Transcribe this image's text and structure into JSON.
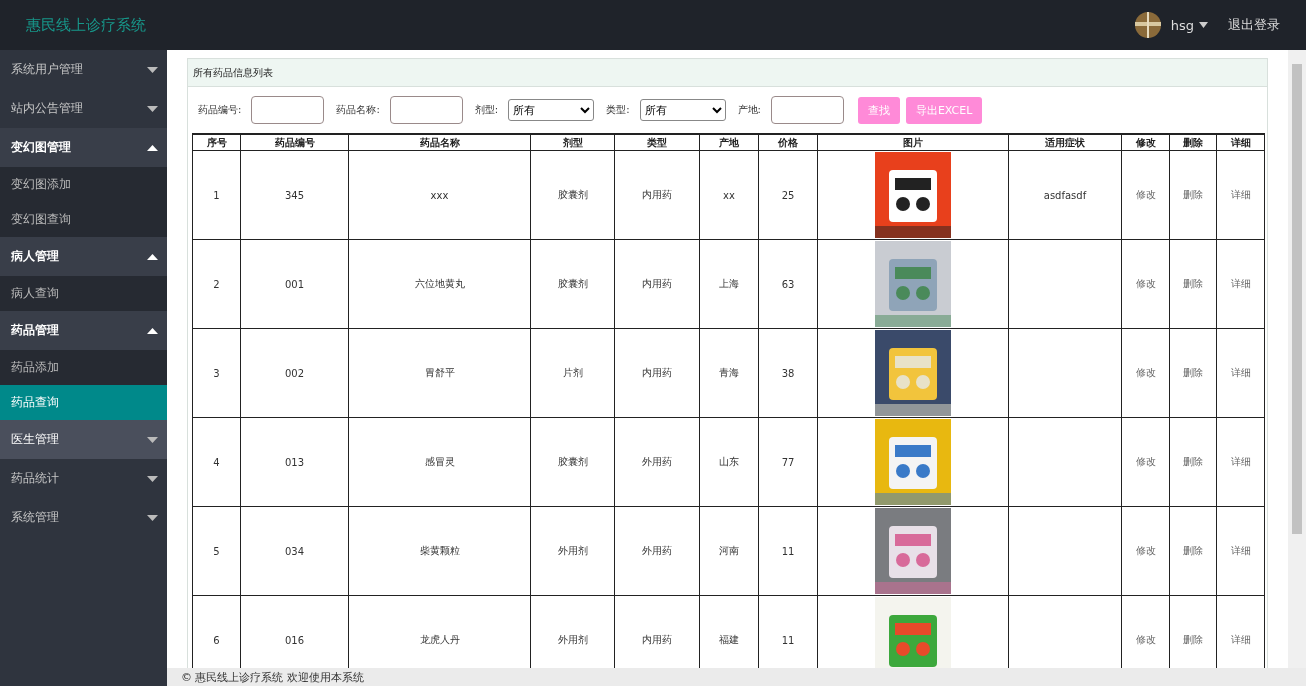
{
  "header": {
    "title": "惠民线上诊疗系统",
    "user": "hsg",
    "logout": "退出登录"
  },
  "sidebar": {
    "items": [
      {
        "label": "系统用户管理",
        "expanded": false,
        "hovered": false
      },
      {
        "label": "站内公告管理",
        "expanded": false,
        "hovered": false
      },
      {
        "label": "变幻图管理",
        "expanded": true,
        "hovered": false,
        "children": [
          {
            "label": "变幻图添加",
            "selected": false
          },
          {
            "label": "变幻图查询",
            "selected": false
          }
        ]
      },
      {
        "label": "病人管理",
        "expanded": true,
        "hovered": false,
        "children": [
          {
            "label": "病人查询",
            "selected": false
          }
        ]
      },
      {
        "label": "药品管理",
        "expanded": true,
        "hovered": false,
        "children": [
          {
            "label": "药品添加",
            "selected": false
          },
          {
            "label": "药品查询",
            "selected": true
          }
        ]
      },
      {
        "label": "医生管理",
        "expanded": false,
        "hovered": true
      },
      {
        "label": "药品统计",
        "expanded": false,
        "hovered": false
      },
      {
        "label": "系统管理",
        "expanded": false,
        "hovered": false
      }
    ]
  },
  "panel": {
    "title": "所有药品信息列表"
  },
  "filters": [
    {
      "kind": "input",
      "label": "药品编号:"
    },
    {
      "kind": "input",
      "label": "药品名称:"
    },
    {
      "kind": "select",
      "label": "剂型:",
      "value": "所有"
    },
    {
      "kind": "select",
      "label": "类型:",
      "value": "所有"
    },
    {
      "kind": "input",
      "label": "产地:"
    }
  ],
  "buttons": [
    "查找",
    "导出EXCEL"
  ],
  "table": {
    "columns": [
      "序号",
      "药品编号",
      "药品名称",
      "剂型",
      "类型",
      "产地",
      "价格",
      "图片",
      "适用症状",
      "修改",
      "删除",
      "详细"
    ],
    "rows": [
      {
        "cells": [
          "1",
          "345",
          "xxx",
          "胶囊剂",
          "内用药",
          "xx",
          "25"
        ],
        "symptoms": "asdfasdf",
        "actions": [
          "修改",
          "删除",
          "详细"
        ]
      },
      {
        "cells": [
          "2",
          "001",
          "六位地黄丸",
          "胶囊剂",
          "内用药",
          "上海",
          "63"
        ],
        "actions": [
          "修改",
          "删除",
          "详细"
        ]
      },
      {
        "cells": [
          "3",
          "002",
          "胃舒平",
          "片剂",
          "内用药",
          "青海",
          "38"
        ],
        "actions": [
          "修改",
          "删除",
          "详细"
        ]
      },
      {
        "cells": [
          "4",
          "013",
          "感冒灵",
          "胶囊剂",
          "外用药",
          "山东",
          "77"
        ],
        "actions": [
          "修改",
          "删除",
          "详细"
        ]
      },
      {
        "cells": [
          "5",
          "034",
          "柴黄颗粒",
          "外用剂",
          "外用药",
          "河南",
          "11"
        ],
        "actions": [
          "修改",
          "删除",
          "详细"
        ]
      },
      {
        "cells": [
          "6",
          "016",
          "龙虎人丹",
          "外用剂",
          "内用药",
          "福建",
          "11"
        ],
        "actions": [
          "修改",
          "删除",
          "详细"
        ]
      }
    ]
  },
  "footer": "© 惠民线上诊疗系统 欢迎使用本系统"
}
